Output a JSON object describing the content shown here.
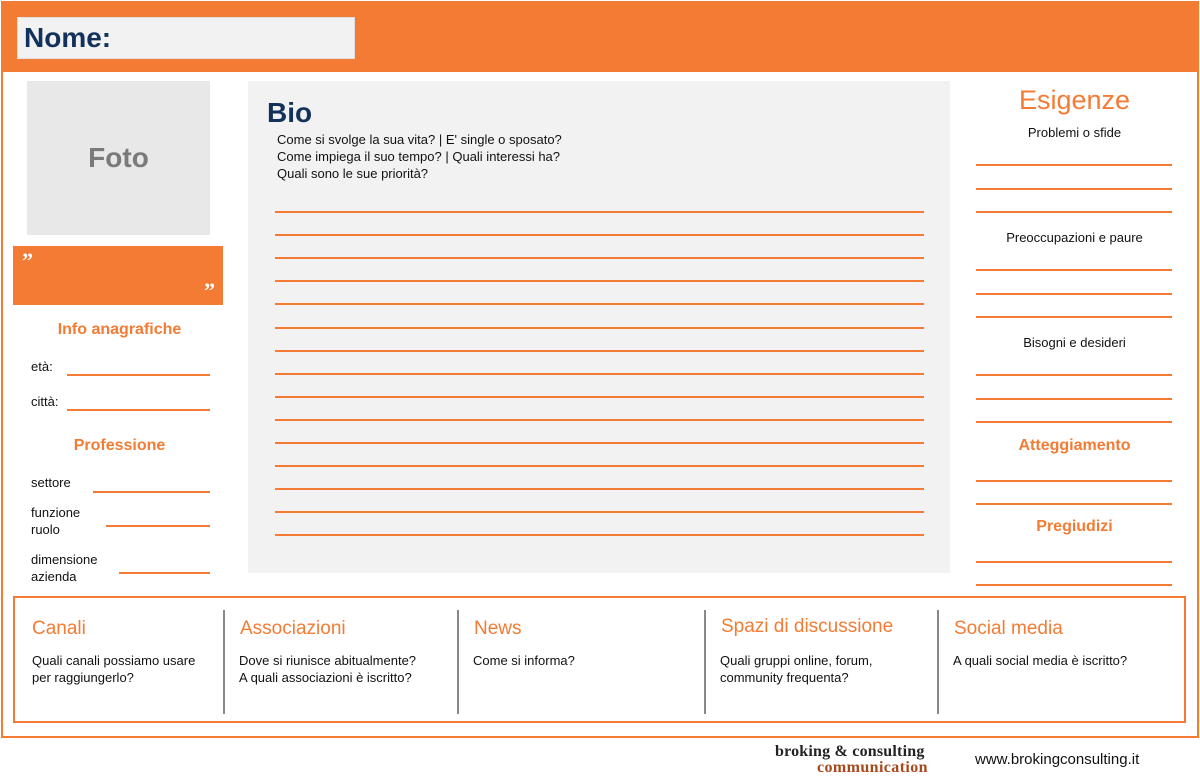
{
  "header": {
    "name_label": "Nome:"
  },
  "left": {
    "photo_label": "Foto",
    "quote_open": "”",
    "quote_close": "”",
    "info_title": "Info anagrafiche",
    "eta_label": "età:",
    "citta_label": "città:",
    "professione_title": "Professione",
    "settore_label": "settore",
    "funzione_label": "funzione\nruolo",
    "dimensione_label": "dimensione\nazienda"
  },
  "bio": {
    "title": "Bio",
    "questions": [
      "Come si svolge la sua vita? | E' single o sposato?",
      "Come impiega il suo tempo? | Quali interessi ha?",
      "Quali sono le sue priorità?"
    ]
  },
  "right": {
    "esigenze_title": "Esigenze",
    "problemi": "Problemi o sfide",
    "preoccupazioni": "Preoccupazioni e paure",
    "bisogni": "Bisogni e desideri",
    "atteggiamento": "Atteggiamento",
    "pregiudizi": "Pregiudizi"
  },
  "bottom": {
    "columns": [
      {
        "title": "Canali",
        "text": "Quali canali possiamo usare\nper raggiungerlo?"
      },
      {
        "title": "Associazioni",
        "text": "Dove si riunisce abitualmente?\nA quali associazioni è iscritto?"
      },
      {
        "title": "News",
        "text": "Come si informa?"
      },
      {
        "title": "Spazi di discussione",
        "text": "Quali gruppi online, forum,\ncommunity frequenta?"
      },
      {
        "title": "Social media",
        "text": "A quali social media è iscritto?"
      }
    ]
  },
  "footer": {
    "logo_line1": "broking & consulting",
    "logo_line2": "communication",
    "website": "www.brokingconsulting.it"
  },
  "colors": {
    "accent": "#f47b34",
    "navy": "#13325b",
    "panel": "#f2f2f2"
  }
}
